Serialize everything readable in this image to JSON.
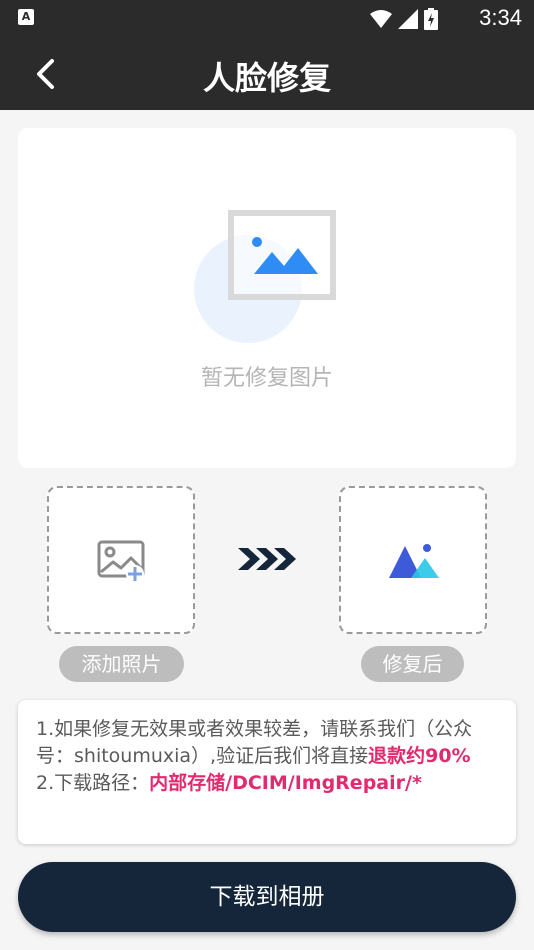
{
  "status_bar": {
    "app_badge": "A",
    "time": "3:34"
  },
  "toolbar": {
    "title": "人脸修复"
  },
  "preview": {
    "empty_text": "暂无修复图片"
  },
  "slots": {
    "add_label": "添加照片",
    "after_label": "修复后"
  },
  "notes": {
    "line1_prefix": "1.如果修复无效果或者效果较差，请联系我们（公众号：shitoumuxia）,验证后我们将直接",
    "line1_highlight": "退款约90%",
    "line2_prefix": "2.下载路径：",
    "line2_highlight": "内部存储/DCIM/ImgRepair/*"
  },
  "download_button": {
    "label": "下载到相册"
  },
  "colors": {
    "toolbar_bg": "#2b2b2b",
    "accent_pink": "#e22a6f",
    "button_bg": "#15253a",
    "icon_blue": "#2f8cf5"
  }
}
